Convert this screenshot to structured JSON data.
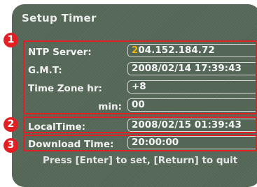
{
  "window": {
    "title": "Setup Timer"
  },
  "fields": {
    "ntp_server": {
      "label": "NTP Server:",
      "value": "204.152.184.72"
    },
    "gmt": {
      "label": "G.M.T:",
      "value": "2008/02/14 17:39:43"
    },
    "time_zone_hr": {
      "label": "Time Zone hr:",
      "value": "+8"
    },
    "time_zone_min": {
      "label": "min:",
      "value": "00"
    },
    "local_time": {
      "label": "LocalTime:",
      "value": "2008/02/15 01:39:43"
    },
    "download_time": {
      "label": "Download Time:",
      "value": "20:00:00"
    }
  },
  "hint": {
    "text": "Press [Enter] to set, [Return] to quit"
  },
  "annotations": {
    "badge_1": "1",
    "badge_2": "2",
    "badge_3": "3"
  },
  "colors": {
    "panel_background": "#546656",
    "annotation_red": "#e41f24",
    "cursor_highlight": "#f4b400"
  }
}
